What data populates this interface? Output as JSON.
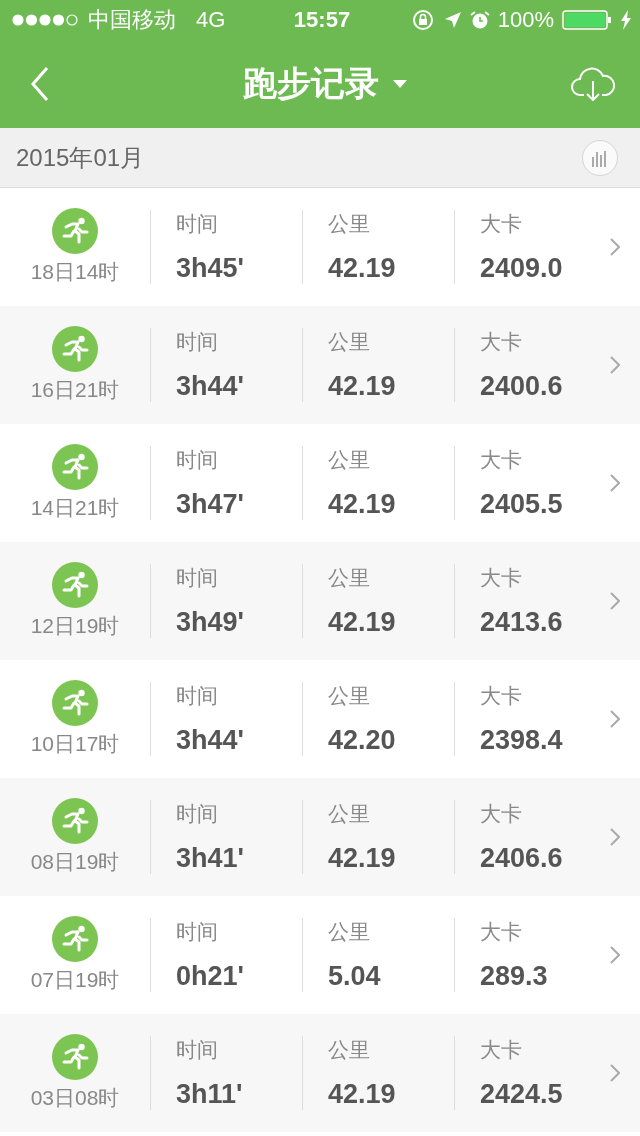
{
  "status_bar": {
    "carrier": "中国移动",
    "network": "4G",
    "time": "15:57",
    "battery": "100%"
  },
  "nav": {
    "title": "跑步记录"
  },
  "section": {
    "title": "2015年01月"
  },
  "records": [
    {
      "when": "18日14时",
      "time_label": "时间",
      "time": "3h45'",
      "distance_label": "公里",
      "distance": "42.19",
      "calories_label": "大卡",
      "calories": "2409.0"
    },
    {
      "when": "16日21时",
      "time_label": "时间",
      "time": "3h44'",
      "distance_label": "公里",
      "distance": "42.19",
      "calories_label": "大卡",
      "calories": "2400.6"
    },
    {
      "when": "14日21时",
      "time_label": "时间",
      "time": "3h47'",
      "distance_label": "公里",
      "distance": "42.19",
      "calories_label": "大卡",
      "calories": "2405.5"
    },
    {
      "when": "12日19时",
      "time_label": "时间",
      "time": "3h49'",
      "distance_label": "公里",
      "distance": "42.19",
      "calories_label": "大卡",
      "calories": "2413.6"
    },
    {
      "when": "10日17时",
      "time_label": "时间",
      "time": "3h44'",
      "distance_label": "公里",
      "distance": "42.20",
      "calories_label": "大卡",
      "calories": "2398.4"
    },
    {
      "when": "08日19时",
      "time_label": "时间",
      "time": "3h41'",
      "distance_label": "公里",
      "distance": "42.19",
      "calories_label": "大卡",
      "calories": "2406.6"
    },
    {
      "when": "07日19时",
      "time_label": "时间",
      "time": "0h21'",
      "distance_label": "公里",
      "distance": "5.04",
      "calories_label": "大卡",
      "calories": "289.3"
    },
    {
      "when": "03日08时",
      "time_label": "时间",
      "time": "3h11'",
      "distance_label": "公里",
      "distance": "42.19",
      "calories_label": "大卡",
      "calories": "2424.5"
    }
  ]
}
